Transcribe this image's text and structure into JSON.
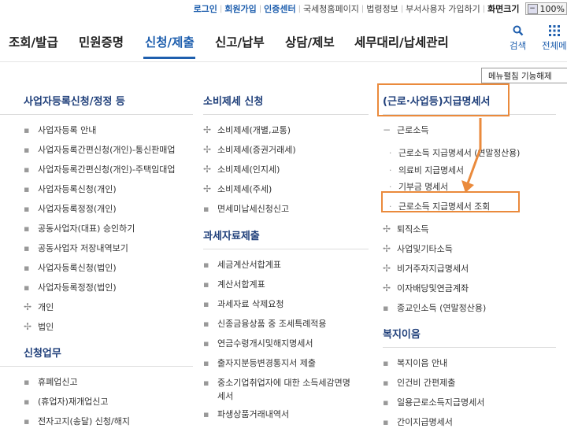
{
  "topbar": {
    "links": [
      "로그인",
      "회원가입",
      "인증센터",
      "국세청홈페이지",
      "법령정보",
      "부서사용자 가입하기",
      "화면크기"
    ],
    "zoom": "100%"
  },
  "gnb": {
    "items": [
      "조회/발급",
      "민원증명",
      "신청/제출",
      "신고/납부",
      "상담/제보",
      "세무대리/납세관리"
    ],
    "search_label": "검색",
    "all_menu_label": "전체메"
  },
  "tooltip": "메뉴펼침 기능해제",
  "col1": {
    "heading": "사업자등록신청/정정 등",
    "items": [
      "사업자등록 안내",
      "사업자등록간편신청(개인)-통신판매업",
      "사업자등록간편신청(개인)-주택임대업",
      "사업자등록신청(개인)",
      "사업자등록정정(개인)",
      "공동사업자(대표) 승인하기",
      "공동사업자 저장내역보기",
      "사업자등록신청(법인)",
      "사업자등록정정(법인)"
    ],
    "plus_items": [
      "개인",
      "법인"
    ],
    "heading2": "신청업무",
    "items2": [
      "휴폐업신고",
      "(휴업자)재개업신고",
      "전자고지(송달) 신청/해지"
    ]
  },
  "col2": {
    "heading": "소비제세 신청",
    "plus_items": [
      "소비제세(개별,교통)",
      "소비제세(증권거래세)",
      "소비제세(인지세)",
      "소비제세(주세)"
    ],
    "bullet_item": "면세미납세신청신고",
    "heading2": "과세자료제출",
    "items2": [
      "세금계산서합계표",
      "계산서합계표",
      "과세자료 삭제요청",
      "신종금융상품 중 조세특례적용",
      "연금수령개시및해지명세서",
      "출자지분등변경통지서 제출",
      "중소기업취업자에 대한 소득세감면명",
      "세서",
      "파생상품거래내역서"
    ]
  },
  "col3": {
    "heading": "(근로·사업등)지급명세서",
    "minus_item": "근로소득",
    "sub_items": [
      "근로소득 지급명세서 (연말정산용)",
      "의료비 지급명세서",
      "기부금 명세서",
      "근로소득 지급명세서 조회"
    ],
    "plus_items": [
      "퇴직소득",
      "사업및기타소득",
      "비거주자지급명세서",
      "이자배당및연금계좌"
    ],
    "bullet_item": "종교인소득 (연말정산용)",
    "heading2": "복지이음",
    "items2": [
      "복지이음 안내",
      "인건비 간편제출",
      "일용근로소득지급명세서",
      "간이지급명세서"
    ]
  },
  "colors": {
    "brand_blue": "#1f5fae",
    "heading_navy": "#1f3f7a",
    "highlight_orange": "#ea8a3c"
  }
}
